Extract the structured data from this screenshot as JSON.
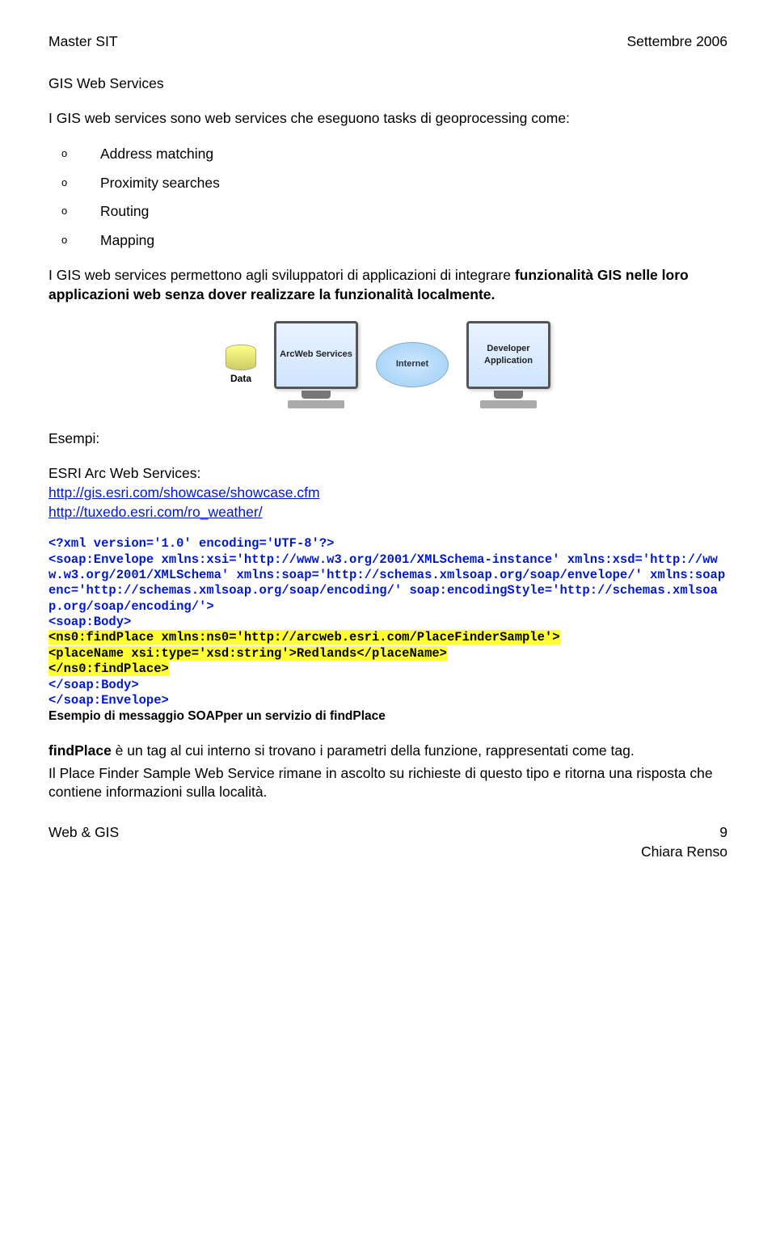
{
  "header": {
    "course": "Master SIT",
    "date": "Settembre 2006"
  },
  "title": "GIS Web Services",
  "intro": "I GIS web services sono web services che eseguono tasks di geoprocessing come:",
  "bullets": [
    "Address matching",
    "Proximity searches",
    "Routing",
    "Mapping"
  ],
  "para2_part1": "I GIS web services permettono agli sviluppatori di applicazioni di integrare ",
  "para2_bold": "funzionalità GIS nelle loro applicazioni web senza dover realizzare la funzionalità localmente.",
  "diagram": {
    "data_label": "Data",
    "server_label": "ArcWeb Services",
    "cloud_label": "Internet",
    "client_label": "Developer Application"
  },
  "examples_label": "Esempi:",
  "esri_label": "ESRI Arc Web Services:",
  "link1": "http://gis.esri.com/showcase/showcase.cfm",
  "link2": "http://tuxedo.esri.com/ro_weather/",
  "code_l1": "<?xml version='1.0' encoding='UTF-8'?>",
  "code_l2": "<soap:Envelope xmlns:xsi='http://www.w3.org/2001/XMLSchema-instance' xmlns:xsd='http://www.w3.org/2001/XMLSchema' xmlns:soap='http://schemas.xmlsoap.org/soap/envelope/' xmlns:soapenc='http://schemas.xmlsoap.org/soap/encoding/' soap:encodingStyle='http://schemas.xmlsoap.org/soap/encoding/'>",
  "code_l3": "<soap:Body>",
  "code_h1": "<ns0:findPlace xmlns:ns0='http://arcweb.esri.com/PlaceFinderSample'>",
  "code_h2": "<placeName xsi:type='xsd:string'>Redlands</placeName>",
  "code_h3": "</ns0:findPlace>",
  "code_l4": "</soap:Body>",
  "code_l5": "</soap:Envelope>",
  "caption": "Esempio di messaggio SOAPper un servizio di findPlace",
  "explain_bold": "findPlace",
  "explain_rest1": " è un tag al cui interno si trovano i parametri della funzione, rappresentati come tag.",
  "explain_rest2": "Il Place Finder Sample Web Service rimane in ascolto su richieste di questo tipo e ritorna una risposta che contiene informazioni sulla località.",
  "footer": {
    "left": "Web & GIS",
    "page": "9",
    "author": "Chiara Renso"
  }
}
